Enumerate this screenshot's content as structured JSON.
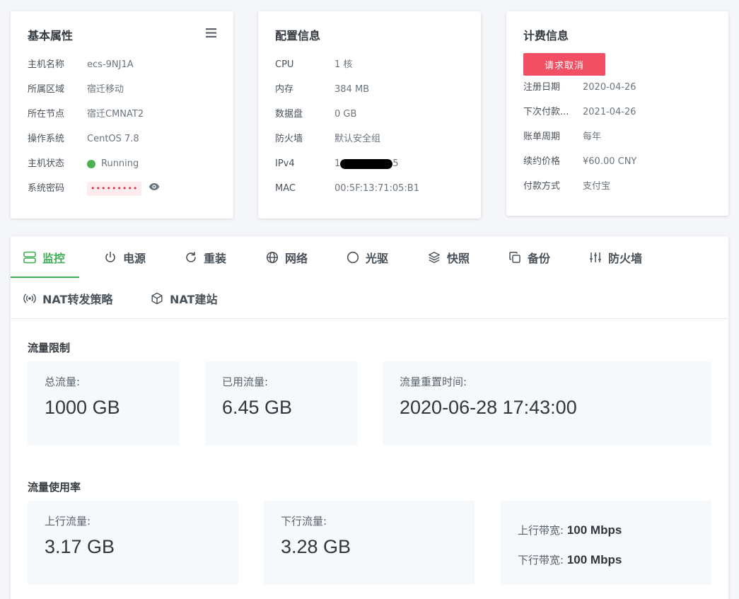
{
  "basic": {
    "title": "基本属性",
    "hostname_label": "主机名称",
    "hostname": "ecs-9NJ1A",
    "region_label": "所属区域",
    "region": "宿迁移动",
    "node_label": "所在节点",
    "node": "宿迁CMNAT2",
    "os_label": "操作系统",
    "os": "CentOS 7.8",
    "status_label": "主机状态",
    "status": "Running",
    "status_color": "#4caf50",
    "password_label": "系统密码",
    "password_mask": "•••••••••"
  },
  "config": {
    "title": "配置信息",
    "cpu_label": "CPU",
    "cpu": "1 核",
    "mem_label": "内存",
    "mem": "384 MB",
    "disk_label": "数据盘",
    "disk": "0 GB",
    "firewall_label": "防火墙",
    "firewall": "默认安全组",
    "ipv4_label": "IPv4",
    "ipv4_start": "1",
    "ipv4_end": "5",
    "mac_label": "MAC",
    "mac": "00:5F:13:71:05:B1"
  },
  "billing": {
    "title": "计费信息",
    "cancel_button": "请求取消",
    "reg_label": "注册日期",
    "reg": "2020-04-26",
    "next_label": "下次付款...",
    "next": "2021-04-26",
    "cycle_label": "账单周期",
    "cycle": "每年",
    "price_label": "续约价格",
    "price": "¥60.00 CNY",
    "method_label": "付款方式",
    "method": "支付宝"
  },
  "tabs": [
    {
      "label": "监控",
      "icon": "monitor-icon",
      "active": true
    },
    {
      "label": "电源",
      "icon": "power-icon"
    },
    {
      "label": "重装",
      "icon": "reload-icon"
    },
    {
      "label": "网络",
      "icon": "globe-icon"
    },
    {
      "label": "光驱",
      "icon": "disc-icon"
    },
    {
      "label": "快照",
      "icon": "layers-icon"
    },
    {
      "label": "备份",
      "icon": "copy-icon"
    },
    {
      "label": "防火墙",
      "icon": "sliders-icon"
    },
    {
      "label": "NAT转发策略",
      "icon": "broadcast-icon"
    },
    {
      "label": "NAT建站",
      "icon": "box-icon"
    }
  ],
  "traffic_limit": {
    "title": "流量限制",
    "total_label": "总流量:",
    "total": "1000 GB",
    "used_label": "已用流量:",
    "used": "6.45 GB",
    "reset_label": "流量重置时间:",
    "reset": "2020-06-28 17:43:00"
  },
  "traffic_usage": {
    "title": "流量使用率",
    "up_label": "上行流量:",
    "up": "3.17 GB",
    "down_label": "下行流量:",
    "down": "3.28 GB",
    "up_bw_label": "上行带宽:",
    "up_bw": "100 Mbps",
    "down_bw_label": "下行带宽:",
    "down_bw": "100 Mbps"
  },
  "colors": {
    "accent": "#3fae55",
    "danger": "#f15064",
    "page_bg": "#f4f6f9"
  }
}
